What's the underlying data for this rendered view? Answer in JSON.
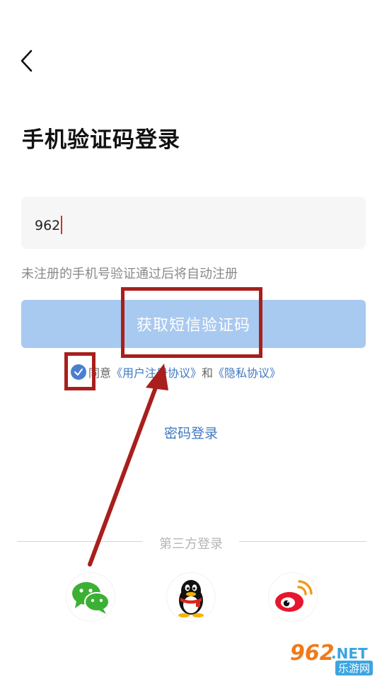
{
  "header": {
    "back_icon": "chevron-left-icon"
  },
  "title": "手机验证码登录",
  "phone": {
    "value": "962"
  },
  "hint": "未注册的手机号验证通过后将自动注册",
  "sms_button": "获取短信验证码",
  "agreement": {
    "prefix": "同意",
    "user_link": "《用户注册协议》",
    "and": "和",
    "privacy_link": "《隐私协议》",
    "checked": true
  },
  "password_login": "密码登录",
  "third_party": {
    "label": "第三方登录",
    "items": [
      {
        "icon": "wechat-icon"
      },
      {
        "icon": "qq-icon"
      },
      {
        "icon": "weibo-icon"
      }
    ]
  },
  "watermark": {
    "big": "962",
    "net": ".NET",
    "small": "乐游网"
  },
  "colors": {
    "accent": "#3f78c0",
    "button": "#a8c9f0",
    "annotation": "#a81f1c"
  }
}
